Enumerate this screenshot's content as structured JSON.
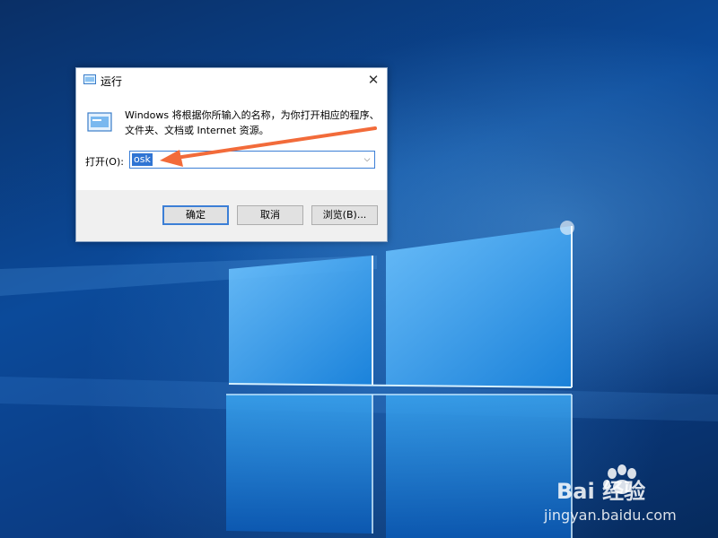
{
  "dialog": {
    "title": "运行",
    "close_glyph": "✕",
    "description_line1": "Windows 将根据你所输入的名称，为你打开相应的程序、",
    "description_line2": "文件夹、文档或 Internet 资源。",
    "open_label": "打开(O):",
    "open_value": "osk",
    "buttons": {
      "ok": "确定",
      "cancel": "取消",
      "browse": "浏览(B)..."
    }
  },
  "annotation": {
    "arrow_color": "#f26b3a"
  },
  "watermark": {
    "brand": "Bai 经验",
    "url": "jingyan.baidu.com"
  },
  "icons": {
    "title_icon": "run-icon",
    "description_icon": "run-icon",
    "dropdown_icon": "chevron-down-icon"
  }
}
